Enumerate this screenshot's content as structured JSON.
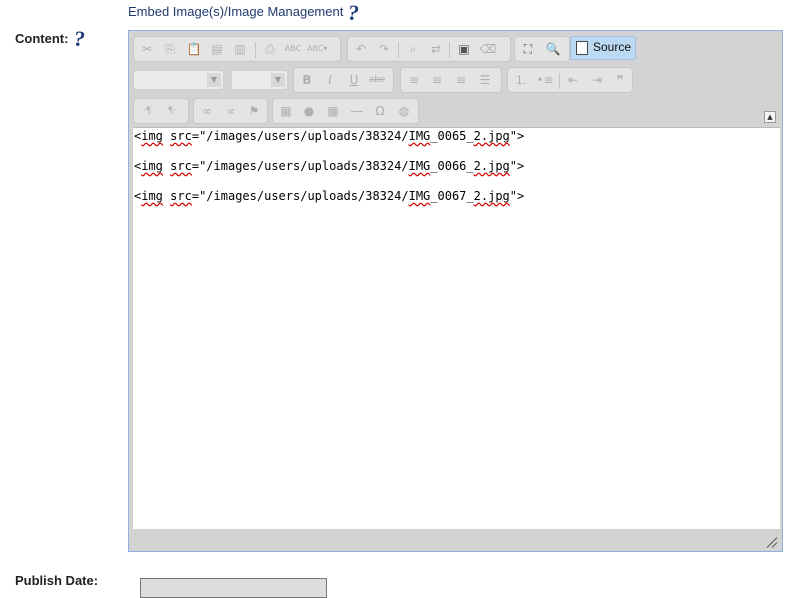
{
  "embed_link": "Embed Image(s)/Image Management",
  "help_glyph": "?",
  "content_label": "Content:",
  "publish_label": "Publish Date:",
  "editor": {
    "source_label": "Source",
    "toolbar_row1": [
      "cut",
      "copy",
      "paste",
      "paste-text",
      "paste-word",
      "print",
      "spellcheck",
      "scayt",
      "undo",
      "redo",
      "find",
      "replace",
      "select-all",
      "remove-format",
      "maximize",
      "preview"
    ],
    "toolbar_row2": [
      "bold",
      "italic",
      "underline",
      "strike",
      "justify-left",
      "justify-center",
      "justify-right",
      "justify-block",
      "numbered-list",
      "bulleted-list",
      "outdent",
      "indent",
      "blockquote"
    ],
    "toolbar_row3": [
      "bidi-ltr",
      "bidi-rtl",
      "link",
      "unlink",
      "anchor",
      "image",
      "flash",
      "table",
      "horizontal-rule",
      "special-char",
      "iframe"
    ],
    "lines": [
      [
        "<",
        "img",
        " ",
        "src",
        "=\"/images/users/uploads/38324/",
        "IMG",
        "_0065_",
        "2.jpg",
        "\">"
      ],
      [
        "<",
        "img",
        " ",
        "src",
        "=\"/images/users/uploads/38324/",
        "IMG",
        "_0066_",
        "2.jpg",
        "\">"
      ],
      [
        "<",
        "img",
        " ",
        "src",
        "=\"/images/users/uploads/38324/",
        "IMG",
        "_0067_",
        "2.jpg",
        "\">"
      ]
    ]
  }
}
